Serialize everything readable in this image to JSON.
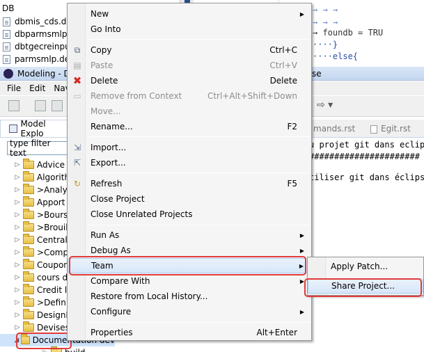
{
  "background_window": {
    "db_label": "DB",
    "files": [
      "dbmis_cds.db",
      "dbparmsmlp.",
      "dbtgecreinput",
      "parmsmlp.del"
    ],
    "code_lines": [
      {
        "text": "→        →        →"
      },
      {
        "text": "→        →        →"
      },
      {
        "text": "→        foundb = TRU"
      },
      {
        "text": "····}"
      },
      {
        "text": "····else{"
      }
    ]
  },
  "modeling_window": {
    "title": "Modeling - D",
    "title_right": "se",
    "menu": [
      "File",
      "Edit",
      "Nav"
    ],
    "view_tab": "Model Explo",
    "filter_placeholder": "type filter text",
    "tree_items": [
      {
        "label": "Advice",
        "prefix": ""
      },
      {
        "label": "Algorith",
        "prefix": ""
      },
      {
        "label": "Analy",
        "prefix": "> "
      },
      {
        "label": "Apport t",
        "prefix": ""
      },
      {
        "label": "Bours",
        "prefix": "> "
      },
      {
        "label": "Brouil",
        "prefix": "> "
      },
      {
        "label": "Centrale",
        "prefix": ""
      },
      {
        "label": "Comp",
        "prefix": "> "
      },
      {
        "label": "Coupon",
        "prefix": ""
      },
      {
        "label": "cours de",
        "prefix": ""
      },
      {
        "label": "Credit le",
        "prefix": ""
      },
      {
        "label": "Defini",
        "prefix": "> "
      },
      {
        "label": "DesignP",
        "prefix": ""
      },
      {
        "label": "Devises",
        "prefix": ""
      },
      {
        "label": "Documentation dev",
        "prefix": ""
      },
      {
        "label": "build",
        "prefix": ""
      }
    ],
    "editor_tabs": [
      "mands.rst",
      "Egit.rst"
    ],
    "editor_lines": [
      "u projet git dans eclips",
      "######################",
      "",
      "tiliser git dans éclipse"
    ]
  },
  "context_menu": {
    "items": [
      {
        "label": "New",
        "shortcut": "",
        "submenu": true,
        "disabled": false,
        "icon": ""
      },
      {
        "label": "Go Into",
        "shortcut": "",
        "submenu": false,
        "disabled": false,
        "icon": ""
      },
      {
        "label": "Copy",
        "shortcut": "Ctrl+C",
        "submenu": false,
        "disabled": false,
        "icon": "copy-icon"
      },
      {
        "label": "Paste",
        "shortcut": "Ctrl+V",
        "submenu": false,
        "disabled": true,
        "icon": "paste-icon"
      },
      {
        "label": "Delete",
        "shortcut": "Delete",
        "submenu": false,
        "disabled": false,
        "icon": "delete-icon"
      },
      {
        "label": "Remove from Context",
        "shortcut": "Ctrl+Alt+Shift+Down",
        "submenu": false,
        "disabled": true,
        "icon": "remove-context-icon"
      },
      {
        "label": "Move...",
        "shortcut": "",
        "submenu": false,
        "disabled": true,
        "icon": ""
      },
      {
        "label": "Rename...",
        "shortcut": "F2",
        "submenu": false,
        "disabled": false,
        "icon": ""
      },
      {
        "label": "Import...",
        "shortcut": "",
        "submenu": false,
        "disabled": false,
        "icon": "import-icon"
      },
      {
        "label": "Export...",
        "shortcut": "",
        "submenu": false,
        "disabled": false,
        "icon": "export-icon"
      },
      {
        "label": "Refresh",
        "shortcut": "F5",
        "submenu": false,
        "disabled": false,
        "icon": "refresh-icon"
      },
      {
        "label": "Close Project",
        "shortcut": "",
        "submenu": false,
        "disabled": false,
        "icon": ""
      },
      {
        "label": "Close Unrelated Projects",
        "shortcut": "",
        "submenu": false,
        "disabled": false,
        "icon": ""
      },
      {
        "label": "Run As",
        "shortcut": "",
        "submenu": true,
        "disabled": false,
        "icon": ""
      },
      {
        "label": "Debug As",
        "shortcut": "",
        "submenu": true,
        "disabled": false,
        "icon": ""
      },
      {
        "label": "Team",
        "shortcut": "",
        "submenu": true,
        "disabled": false,
        "icon": ""
      },
      {
        "label": "Compare With",
        "shortcut": "",
        "submenu": true,
        "disabled": false,
        "icon": ""
      },
      {
        "label": "Restore from Local History...",
        "shortcut": "",
        "submenu": false,
        "disabled": false,
        "icon": ""
      },
      {
        "label": "Configure",
        "shortcut": "",
        "submenu": true,
        "disabled": false,
        "icon": ""
      },
      {
        "label": "Properties",
        "shortcut": "Alt+Enter",
        "submenu": false,
        "disabled": false,
        "icon": ""
      }
    ]
  },
  "team_submenu": {
    "items": [
      "Apply Patch...",
      "Share Project..."
    ]
  },
  "colors": {
    "highlight_border": "#e23a3a",
    "selection": "#d7e7f9"
  }
}
